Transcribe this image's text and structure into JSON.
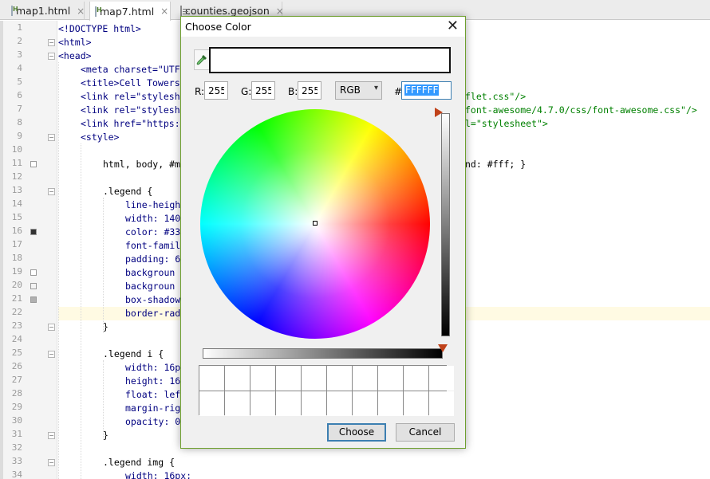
{
  "tabs": [
    {
      "label": "map1.html",
      "icon": "html-file-icon",
      "active": false
    },
    {
      "label": "map7.html",
      "icon": "html-file-icon",
      "active": true
    },
    {
      "label": "counties.geojson",
      "icon": "geojson-file-icon",
      "active": false
    }
  ],
  "tab_close_glyph": "×",
  "line_numbers": [
    "1",
    "2",
    "3",
    "4",
    "5",
    "6",
    "7",
    "8",
    "9",
    "10",
    "11",
    "12",
    "13",
    "14",
    "15",
    "16",
    "17",
    "18",
    "19",
    "20",
    "21",
    "22",
    "23",
    "24",
    "25",
    "26",
    "27",
    "28",
    "29",
    "30",
    "31",
    "32",
    "33",
    "34"
  ],
  "gutter_swatches": {
    "line16": "#333333",
    "line19": "#ffffff",
    "line20": "#f3f3f3",
    "line21": "#b0b0b0"
  },
  "code": {
    "l1": "<!DOCTYPE html>",
    "l2": "<html>",
    "l3": "<head>",
    "l4": "<meta charset=\"UTF",
    "l5": "<title>Cell Towers",
    "l6a": "<link rel=\"stylesh",
    "l6b": "flet.css\"/>",
    "l7a": "<link rel=\"stylesh",
    "l7b": "font-awesome/4.7.0/css/font-awesome.css\"/>",
    "l8a": "<link href=\"https:",
    "l8b": "l=\"stylesheet\">",
    "l9": "<style>",
    "l11a": "html, body, #m",
    "l11b": "nd: #fff; }",
    "l13": ".legend {",
    "l14": "line-heigh",
    "l15": "width: 140",
    "l16": "color: #33",
    "l17": "font-famil",
    "l18": "padding: 6",
    "l19": "backgroun",
    "l20": "backgroun",
    "l21": "box-shadow",
    "l22": "border-rad",
    "l23": "}",
    "l25": ".legend i {",
    "l26": "width: 16p",
    "l27": "height: 16",
    "l28": "float: lef",
    "l29": "margin-rig",
    "l30": "opacity: 0",
    "l31": "}",
    "l33": ".legend img {",
    "l34": "width: 16px;"
  },
  "dialog": {
    "title": "Choose Color",
    "close_glyph": "✕",
    "current_color": "#FFFFFF",
    "r_label": "R:",
    "r_value": "255",
    "g_label": "G:",
    "g_value": "255",
    "b_label": "B:",
    "b_value": "255",
    "mode_value": "RGB",
    "mode_arrow": "▾",
    "hash_label": "#",
    "hex_value": "FFFFFF",
    "brightness_level": 0,
    "opacity_level": 1,
    "choose_label": "Choose",
    "cancel_label": "Cancel",
    "swatch_rows": 2,
    "swatch_cols": 10
  }
}
